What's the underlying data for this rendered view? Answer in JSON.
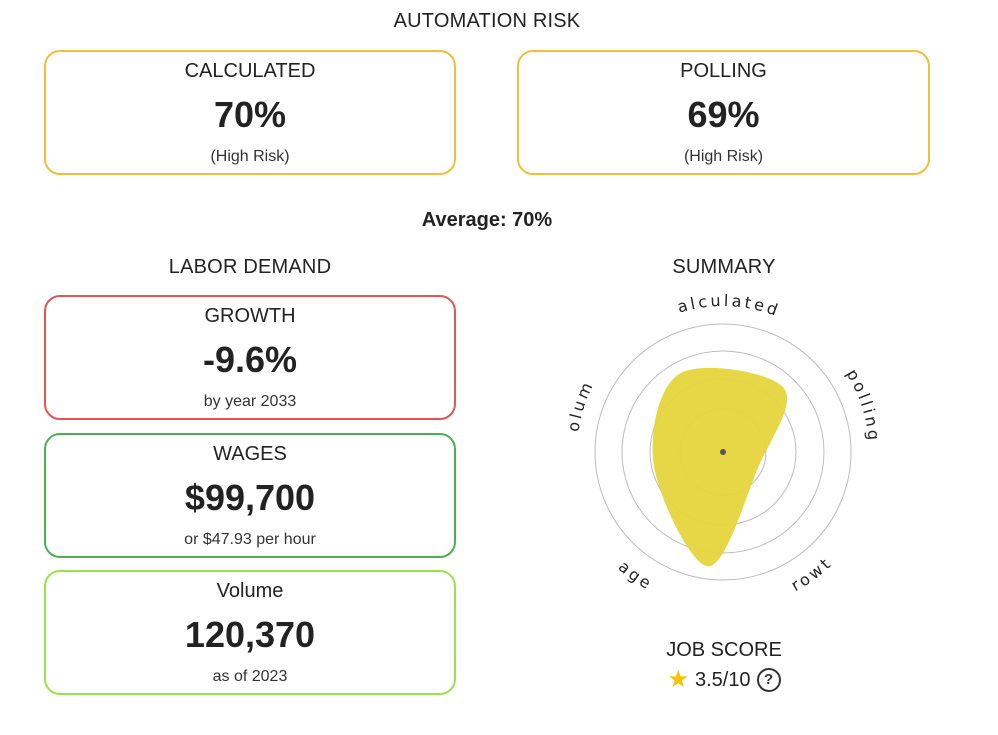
{
  "automation_risk": {
    "title": "AUTOMATION RISK",
    "calculated": {
      "label": "CALCULATED",
      "value": "70%",
      "sub": "(High Risk)"
    },
    "polling": {
      "label": "POLLING",
      "value": "69%",
      "sub": "(High Risk)"
    },
    "average": "Average: 70%"
  },
  "labor_demand": {
    "title": "LABOR DEMAND",
    "growth": {
      "label": "GROWTH",
      "value": "-9.6%",
      "sub": "by year 2033"
    },
    "wages": {
      "label": "WAGES",
      "value": "$99,700",
      "sub": "or $47.93 per hour"
    },
    "volume": {
      "label": "Volume",
      "value": "120,370",
      "sub": "as of 2023"
    }
  },
  "summary": {
    "title": "SUMMARY",
    "axes": [
      "calculated",
      "polling",
      "growth",
      "wages",
      "volume"
    ],
    "levels": [
      0.7,
      0.69,
      0.3,
      0.9,
      0.55
    ],
    "fill_color": "#e6d43c"
  },
  "job_score": {
    "title": "JOB SCORE",
    "star_icon": "★",
    "value": "3.5/10",
    "help_icon": "?"
  },
  "colors": {
    "risk_border": "#f0bf3a",
    "growth_border": "#e05555",
    "wages_border": "#4caf50",
    "volume_border": "#9be04f"
  }
}
